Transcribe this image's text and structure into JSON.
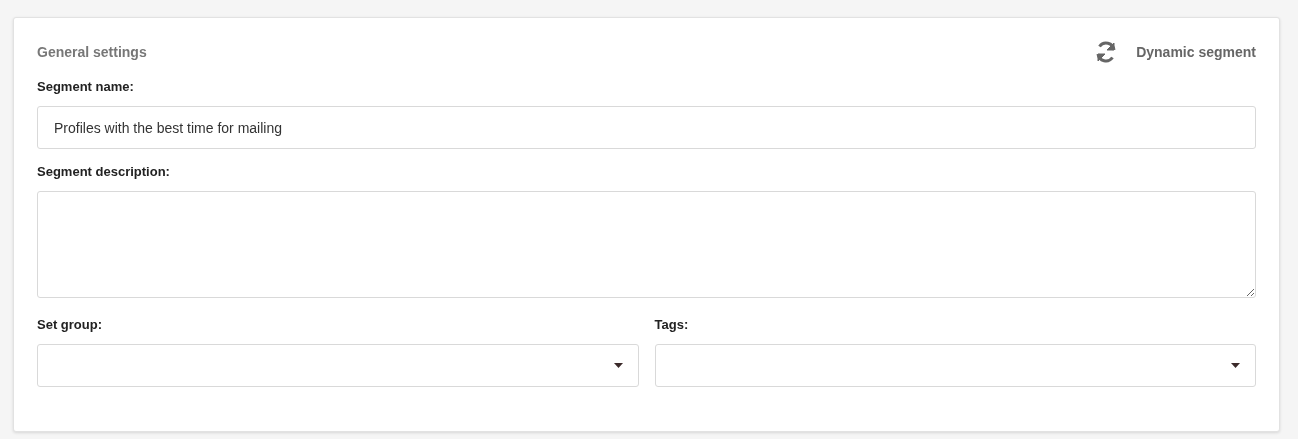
{
  "card": {
    "title": "General settings",
    "mode_label": "Dynamic segment"
  },
  "fields": [
    {
      "kind": "input",
      "label": "Segment name:",
      "value": "Profiles with the best time for mailing"
    },
    {
      "kind": "textarea",
      "label": "Segment description:"
    }
  ],
  "selects": [
    {
      "label": "Set group:"
    },
    {
      "label": "Tags:"
    }
  ]
}
